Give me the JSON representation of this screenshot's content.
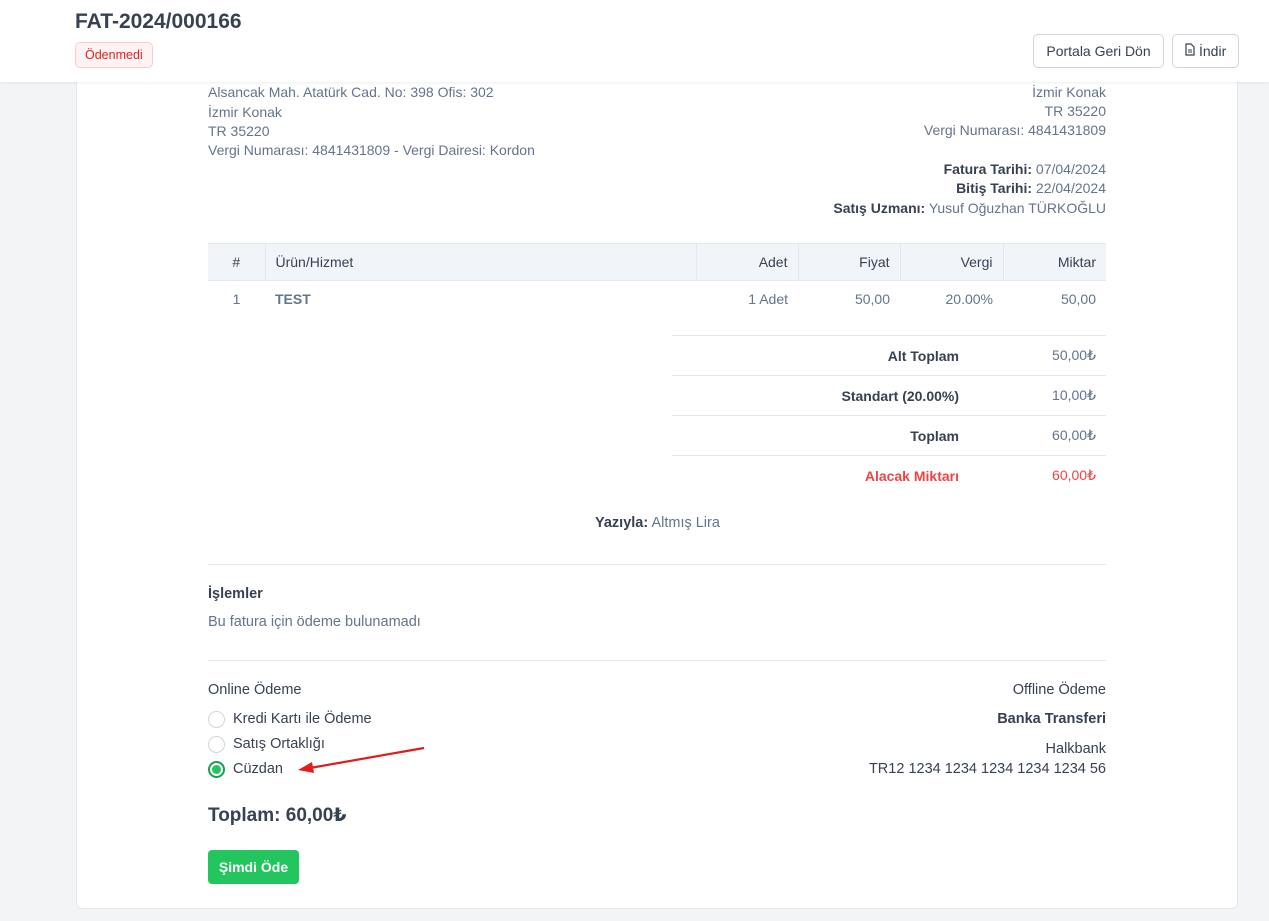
{
  "header": {
    "invoice_number": "FAT-2024/000166",
    "status": "Ödenmedi",
    "portal_button": "Portala Geri Dön",
    "download_button": "İndir"
  },
  "seller": {
    "address_line": "Alsancak Mah. Atatürk Cad. No: 398 Ofis: 302",
    "city": "İzmir Konak",
    "postal": "TR 35220",
    "tax": "Vergi Numarası: 4841431809 - Vergi Dairesi: Kordon"
  },
  "buyer": {
    "city": "İzmir Konak",
    "postal": "TR 35220",
    "tax": "Vergi Numarası: 4841431809"
  },
  "meta": {
    "invoice_date_label": "Fatura Tarihi:",
    "invoice_date": "07/04/2024",
    "due_date_label": "Bitiş Tarihi:",
    "due_date": "22/04/2024",
    "sales_rep_label": "Satış Uzmanı:",
    "sales_rep": "Yusuf Oğuzhan TÜRKOĞLU"
  },
  "table": {
    "headers": [
      "#",
      "Ürün/Hizmet",
      "Adet",
      "Fiyat",
      "Vergi",
      "Miktar"
    ],
    "rows": [
      {
        "no": "1",
        "product": "TEST",
        "qty": "1 Adet",
        "price": "50,00",
        "tax": "20.00%",
        "amount": "50,00"
      }
    ]
  },
  "totals": {
    "subtotal_label": "Alt Toplam",
    "subtotal": "50,00₺",
    "tax_label": "Standart (20.00%)",
    "tax": "10,00₺",
    "total_label": "Toplam",
    "total": "60,00₺",
    "due_label": "Alacak Miktarı",
    "due": "60,00₺"
  },
  "in_words": {
    "label": "Yazıyla:",
    "value": "Altmış Lira"
  },
  "transactions": {
    "title": "İşlemler",
    "empty": "Bu fatura için ödeme bulunamadı"
  },
  "online_payment": {
    "title": "Online Ödeme",
    "options": [
      "Kredi Kartı ile Ödeme",
      "Satış Ortaklığı",
      "Cüzdan"
    ],
    "selected": "Cüzdan"
  },
  "offline_payment": {
    "title": "Offline Ödeme",
    "method": "Banka Transferi",
    "bank": "Halkbank",
    "iban": "TR12 1234 1234 1234 1234 1234 56"
  },
  "payment": {
    "total_text": "Toplam: 60,00₺",
    "pay_button": "Şimdi Öde"
  },
  "colors": {
    "accent_green": "#22c55e",
    "danger_red": "#ef4444",
    "annotation_arrow": "#e11d1d"
  }
}
